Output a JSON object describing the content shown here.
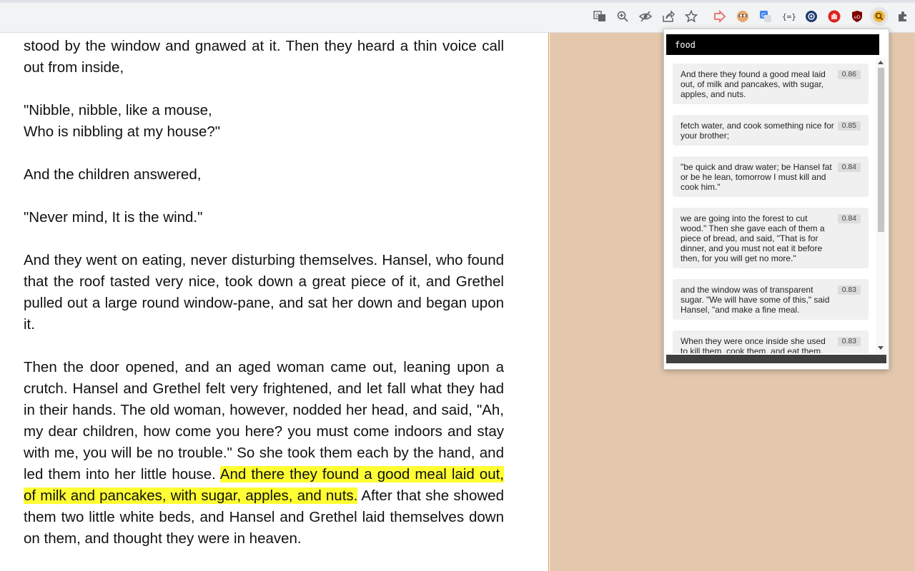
{
  "toolbar": {
    "icons": [
      "translate-icon",
      "zoom-icon",
      "eye-slash-icon",
      "share-icon",
      "bookmark-star-icon",
      "extension-arrow-icon",
      "extension-avatar-icon",
      "extension-translate-icon",
      "extension-json-icon",
      "extension-circle-icon",
      "extension-hand-icon",
      "ublock-icon",
      "semantic-search-icon",
      "puzzle-icon"
    ],
    "ublock_label": "uD"
  },
  "story": {
    "p1": "stood by the window and gnawed at it. Then they heard a thin voice call out from inside,",
    "p2_line1": "\"Nibble, nibble, like a mouse,",
    "p2_line2": "Who is nibbling at my house?\"",
    "p3": "And the children answered,",
    "p4": "\"Never mind, It is the wind.\"",
    "p5": "And they went on eating, never disturbing themselves. Hansel, who found that the roof tasted very nice, took down a great piece of it, and Grethel pulled out a large round window-pane, and sat her down and began upon it.",
    "p6_before": "Then the door opened, and an aged woman came out, leaning upon a crutch. Hansel and Grethel felt very frightened, and let fall what they had in their hands. The old woman, however, nodded her head, and said, \"Ah, my dear children, how come you here? you must come indoors and stay with me, you will be no trouble.\" So she took them each by the hand, and led them into her little house. ",
    "p6_highlight": "And there they found a good meal laid out, of milk and pancakes, with sugar, apples, and nuts.",
    "p6_after": " After that she showed them two little white beds, and Hansel and Grethel laid themselves down on them, and thought they were in heaven.",
    "highlight_color": "#ffff33"
  },
  "popup": {
    "query": "food",
    "results": [
      {
        "text": "And there they found a good meal laid out, of milk and pancakes, with sugar, apples, and nuts.",
        "score": "0.86"
      },
      {
        "text": "fetch water, and cook something nice for your brother;",
        "score": "0.85"
      },
      {
        "text": "\"be quick and draw water; be Hansel fat or be he lean, tomorrow I must kill and cook him.\"",
        "score": "0.84"
      },
      {
        "text": "we are going into the forest to cut wood.\" Then she gave each of them a piece of bread, and said, \"That is for dinner, and you must not eat it before then, for you will get no more.\"",
        "score": "0.84"
      },
      {
        "text": "and the window was of transparent sugar. \"We will have some of this,\" said Hansel, \"and make a fine meal.",
        "score": "0.83"
      },
      {
        "text": "When they were once inside she used to kill them, cook them, and eat them, and",
        "score": "0.83"
      }
    ]
  },
  "colors": {
    "page_background": "#e4c8ae",
    "toolbar": "#f1f3f4"
  }
}
